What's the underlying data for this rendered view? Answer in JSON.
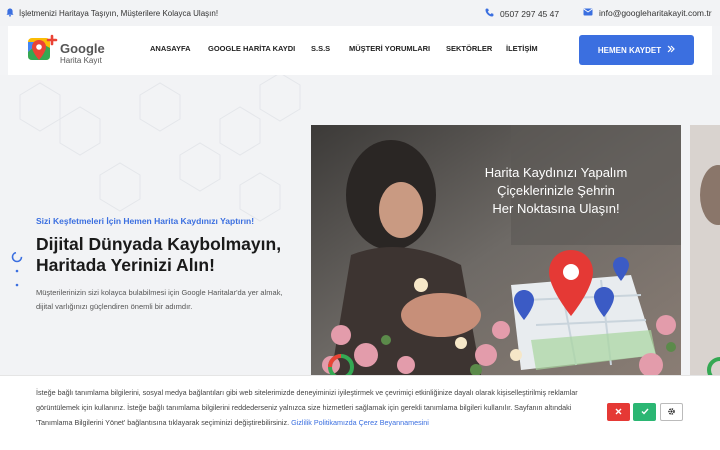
{
  "topbar": {
    "notice": "İşletmenizi Haritaya Taşıyın, Müşterilere Kolayca Ulaşın!",
    "phone": "0507 297 45 47",
    "email": "info@googleharitakayit.com.tr"
  },
  "logo": {
    "line1": "Google",
    "line2": "Harita Kayıt"
  },
  "nav": {
    "items": [
      "ANASAYFA",
      "GOOGLE HARİTA KAYDI",
      "S.S.S",
      "MÜŞTERİ YORUMLARI",
      "SEKTÖRLER",
      "İLETİŞİM"
    ],
    "cta": "HEMEN KAYDET"
  },
  "hero": {
    "tagline": "Sizi Keşfetmeleri İçin Hemen Harita Kaydınızı Yaptırın!",
    "title": "Dijital Dünyada Kaybolmayın, Haritada Yerinizi Alın!",
    "description": "Müşterilerinizin sizi kolayca bulabilmesi için Google Haritalar'da yer almak, dijital varlığınızı güçlendiren önemli bir adımdır.",
    "slide_caption": [
      "Harita Kaydınızı Yapalım",
      "Çiçeklerinizle Şehrin",
      "Her Noktasına Ulaşın!"
    ]
  },
  "cookie": {
    "text": "İsteğe bağlı tanımlama bilgilerini, sosyal medya bağlantıları gibi web sitelerimizde deneyiminizi iyileştirmek ve çevrimiçi etkinliğinize dayalı olarak kişiselleştirilmiş reklamlar görüntülemek için kullanırız. İsteğe bağlı tanımlama bilgilerini reddederseniz yalnızca size hizmetleri sağlamak için gerekli tanımlama bilgileri kullanılır. Sayfanın altındaki 'Tanımlama Bilgilerini Yönet' bağlantısına tıklayarak seçiminizi değiştirebilirsiniz.",
    "link": "Gizlilik Politikamızda Çerez Beyannamesini"
  },
  "colors": {
    "accent": "#3b6fe0",
    "reject": "#e53935",
    "accept": "#2bb673"
  },
  "icons": {
    "notice": "bell-icon",
    "phone": "phone-icon",
    "email": "envelope-icon",
    "cta": "double-chevron-right-icon",
    "reject": "close-icon",
    "accept": "check-icon",
    "settings": "gear-icon"
  }
}
